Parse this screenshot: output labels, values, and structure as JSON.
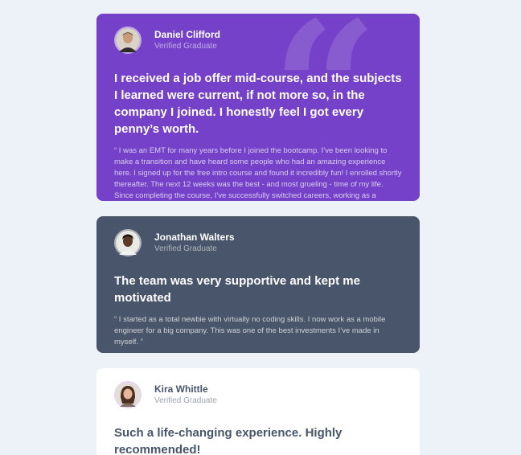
{
  "colors": {
    "page_background": "#ECF2F8",
    "card_purple": "#7541C8",
    "card_slate": "#48556A",
    "card_white": "#FFFFFF"
  },
  "testimonials": [
    {
      "name": "Daniel Clifford",
      "role": "Verified Graduate",
      "headline": "I received a job offer mid-course, and the subjects I learned were current, if not more so, in the company I joined. I honestly feel I got every penny’s worth.",
      "body": "“ I was an EMT for many years before I joined the bootcamp. I’ve been looking to make a transition and have heard some people who had an amazing experience here. I signed up for the free intro course and found it incredibly fun! I enrolled shortly thereafter. The next 12 weeks was the best - and most grueling - time of my life. Since completing the course, I’ve successfully switched careers, working as a Software Engineer at a VR startup. ”",
      "quote_glyph": "“"
    },
    {
      "name": "Jonathan Walters",
      "role": "Verified Graduate",
      "headline": "The team was very supportive and kept me motivated",
      "body": "“ I started as a total newbie with virtually no coding skills. I now work as a mobile engineer for a big company. This was one of the best investments I’ve made in myself. ”"
    },
    {
      "name": "Kira Whittle",
      "role": "Verified Graduate",
      "headline": "Such a life-changing experience. Highly recommended!"
    }
  ]
}
